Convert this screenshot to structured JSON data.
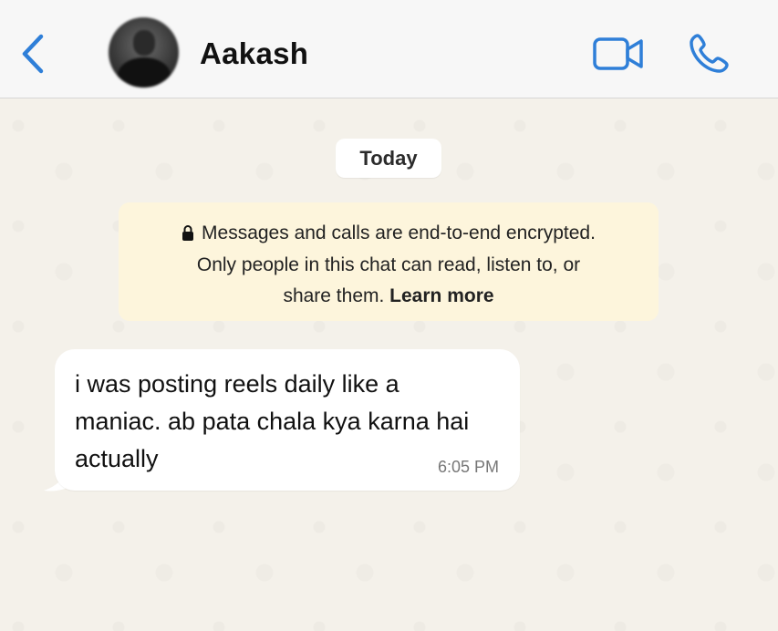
{
  "header": {
    "contact_name": "Aakash",
    "icons": {
      "back": "chevron-left-icon",
      "video": "video-camera-icon",
      "call": "phone-icon"
    },
    "accent_color": "#2f7fd8"
  },
  "chat": {
    "date_chip": "Today",
    "encryption_notice": {
      "line1": "Messages and calls are end-to-end encrypted.",
      "line2": "Only people in this chat can read, listen to, or",
      "line3_prefix": "share them. ",
      "learn_more": "Learn more"
    },
    "messages": [
      {
        "direction": "incoming",
        "text": "i was posting reels daily like a maniac. ab pata chala kya karna hai actually",
        "time": "6:05 PM"
      }
    ]
  }
}
